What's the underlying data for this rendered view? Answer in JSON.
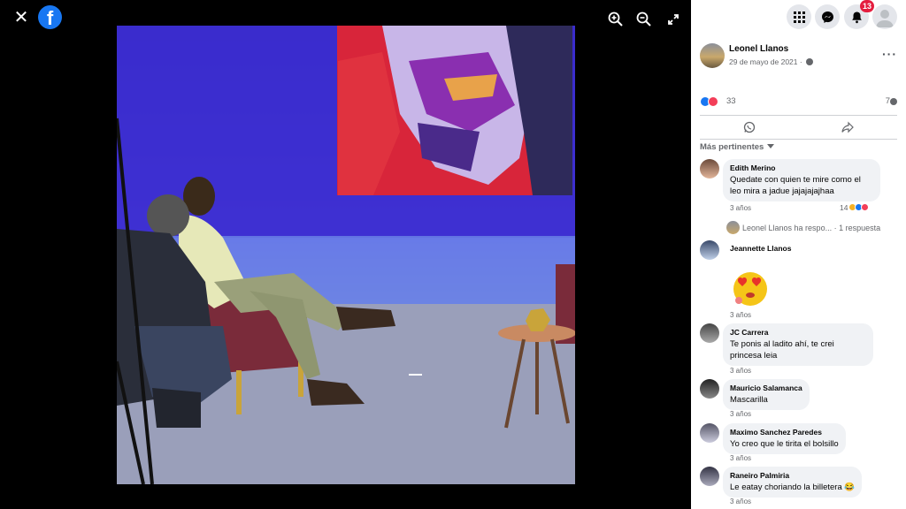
{
  "viewer": {
    "close_label": "✕",
    "logo_letter": "f"
  },
  "post": {
    "author": "Leonel Llanos",
    "date": "29 de mayo de 2021 ·",
    "more_label": "···",
    "reaction_count": "33",
    "comment_count": "7"
  },
  "topbar": {
    "notification_count": "13"
  },
  "comments_filter": "Más pertinentes",
  "comments": [
    {
      "name": "Edith Merino",
      "text": "Quedate con quien te mire como el leo mira a jadue jajajajajhaa",
      "time": "3 años",
      "reacts": "14"
    },
    {
      "name": "Jeannette Llanos",
      "text": "",
      "time": "3 años"
    },
    {
      "name": "JC Carrera",
      "text": "Te ponis al ladito ahí, te crei princesa leia",
      "time": "3 años"
    },
    {
      "name": "Mauricio Salamanca",
      "text": "Mascarilla",
      "time": "3 años"
    },
    {
      "name": "Maximo Sanchez Paredes",
      "text": "Yo creo que le tirita el bolsillo",
      "time": "3 años"
    },
    {
      "name": "Raneiro Palmiria",
      "text": "Le eatay choriando la billetera 😂",
      "time": "3 años"
    }
  ],
  "reply": {
    "text": "Leonel Llanos ha respo...",
    "count": " · 1 respuesta"
  },
  "colors": {
    "facebook_blue": "#1877f2",
    "love_red": "#f33e58",
    "bubble_gray": "#f0f2f5",
    "badge_red": "#e41e3f"
  }
}
